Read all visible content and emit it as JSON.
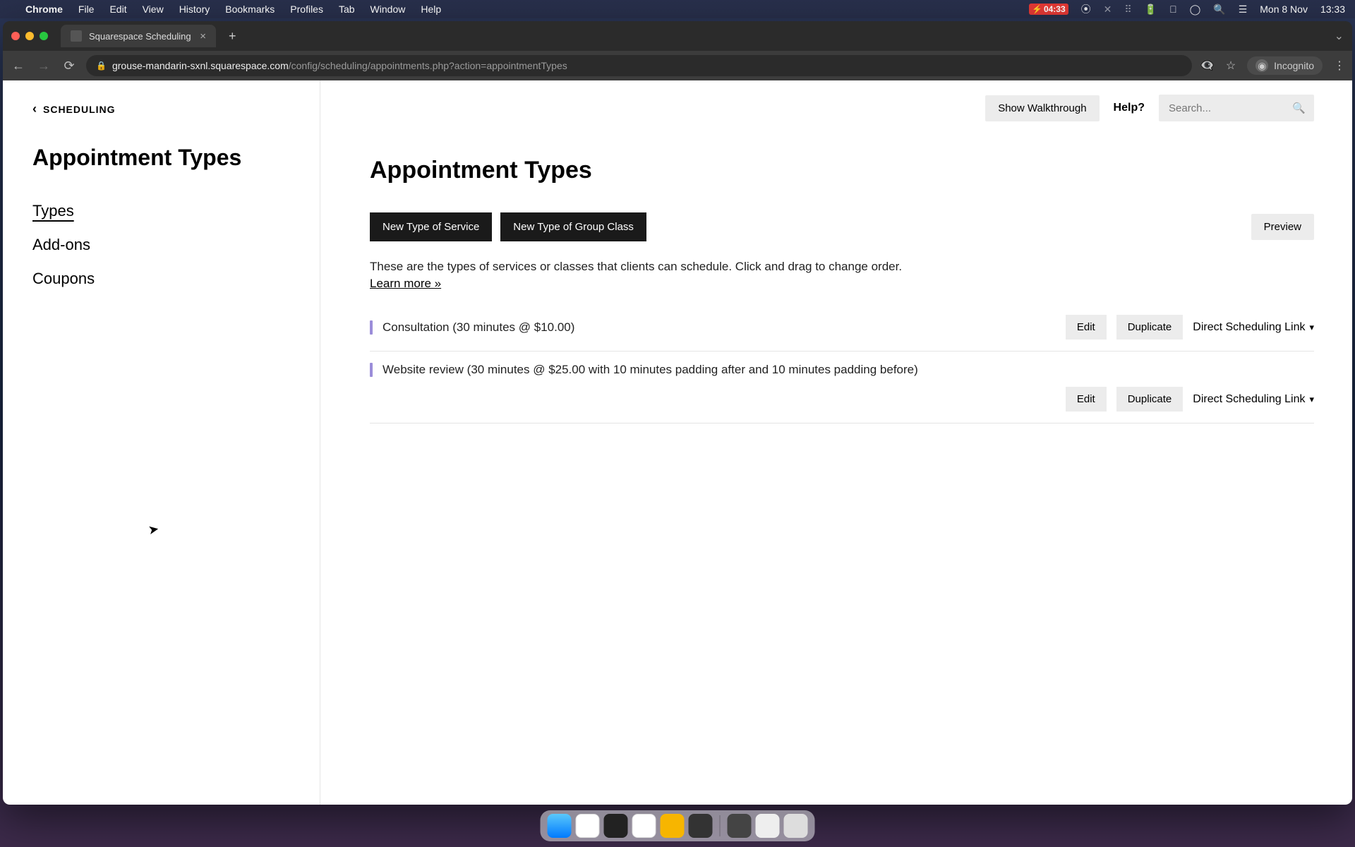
{
  "menubar": {
    "app": "Chrome",
    "items": [
      "File",
      "Edit",
      "View",
      "History",
      "Bookmarks",
      "Profiles",
      "Tab",
      "Window",
      "Help"
    ],
    "battery_time": "04:33",
    "date": "Mon 8 Nov",
    "time": "13:33"
  },
  "tab": {
    "title": "Squarespace Scheduling"
  },
  "address": {
    "domain": "grouse-mandarin-sxnl.squarespace.com",
    "path": "/config/scheduling/appointments.php?action=appointmentTypes"
  },
  "incognito_label": "Incognito",
  "sidebar": {
    "back": "SCHEDULING",
    "title": "Appointment Types",
    "items": [
      {
        "label": "Types",
        "active": true
      },
      {
        "label": "Add-ons",
        "active": false
      },
      {
        "label": "Coupons",
        "active": false
      }
    ]
  },
  "topbar": {
    "walkthrough": "Show Walkthrough",
    "help": "Help?",
    "search_placeholder": "Search..."
  },
  "main": {
    "title": "Appointment Types",
    "new_service": "New Type of Service",
    "new_group": "New Type of Group Class",
    "preview": "Preview",
    "description": "These are the types of services or classes that clients can schedule. Click and drag to change order.",
    "learn_more": "Learn more »",
    "edit": "Edit",
    "duplicate": "Duplicate",
    "direct_link": "Direct Scheduling Link",
    "types": [
      {
        "label": "Consultation (30 minutes @ $10.00)"
      },
      {
        "label": "Website review (30 minutes @ $25.00 with 10 minutes padding after and 10 minutes padding before)"
      }
    ]
  }
}
